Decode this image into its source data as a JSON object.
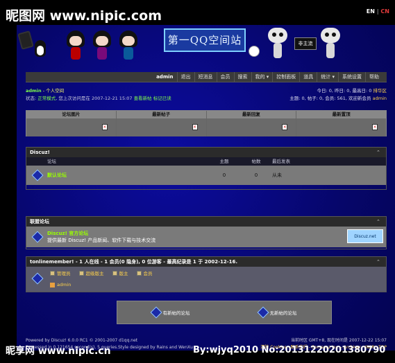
{
  "watermark": {
    "top": "昵图网 www.nipic.com",
    "bottom": "昵享网 www.nipic.cn",
    "byline": "By:wjyq2010 No:20131220201380790"
  },
  "lang": {
    "en": "EN",
    "sep": "|",
    "cn": "CN"
  },
  "banner": {
    "title": "第一QQ空间站",
    "sign": "非主流"
  },
  "nav": [
    "admin",
    "退出",
    "短消息",
    "会员",
    "搜索",
    "我的 ▾",
    "控制面板",
    "道具",
    "统计 ▾",
    "系统设置",
    "帮助"
  ],
  "user": {
    "name": "admin",
    "line1_rest": " - 个人空间",
    "line2_prefix": "状态: ",
    "status": "正常模式",
    "line2_mid": ", 您上次访问是在 2007-12-21 15:07 ",
    "link_new": "查看新帖",
    "link_read": "标记已读",
    "stats1_prefix": "今日: 0, 昨日: 0, 最高日: 0 ",
    "stats1_link": "排华区",
    "stats2_prefix": "主题: 0, 帖子: 0, 会员: 561, 欢迎新会员 ",
    "stats2_name": "admin"
  },
  "quad": {
    "headers": [
      "论坛图片",
      "最新帖子",
      "最新回复",
      "最新置顶"
    ]
  },
  "discuz": {
    "title": "Discuz!",
    "col_forum": "论坛",
    "col_topics": "主题",
    "col_posts": "帖数",
    "col_last": "最后发表",
    "forum_name": "默认论坛",
    "topics": "0",
    "posts": "0",
    "last": "从未"
  },
  "links": {
    "title": "联盟论坛",
    "name": "Discuz! 官方论坛",
    "desc": "提供最新 Discuz! 产品新闻、软件下载与技术交流",
    "logo": "Discuz.net"
  },
  "online": {
    "title": "tonlinemember! - 1 人在线 - 1 会员(0 隐身), 0 位游客 - 最高纪录是 1 于 2002-12-16.",
    "legend": [
      "管理员",
      "超级版主",
      "版主",
      "会员"
    ],
    "me": "admin"
  },
  "newbox": {
    "a": "有新帖的论坛",
    "b": "无新帖的论坛"
  },
  "footer": {
    "l1": "Powered by Discuz! 6.0.0 RC1 © 2001-2007 d1qq.net",
    "l2": "Processed in 0.121654 second(s), 5 queries.Style designed by Rains and WenXu",
    "r1": "当前时区 GMT+8, 现在时间是 2007-12-22 15:07",
    "r2": "清除 Cookies - 联系我们 - Comsenz Inc. - Archiver - WAP - TOP"
  }
}
